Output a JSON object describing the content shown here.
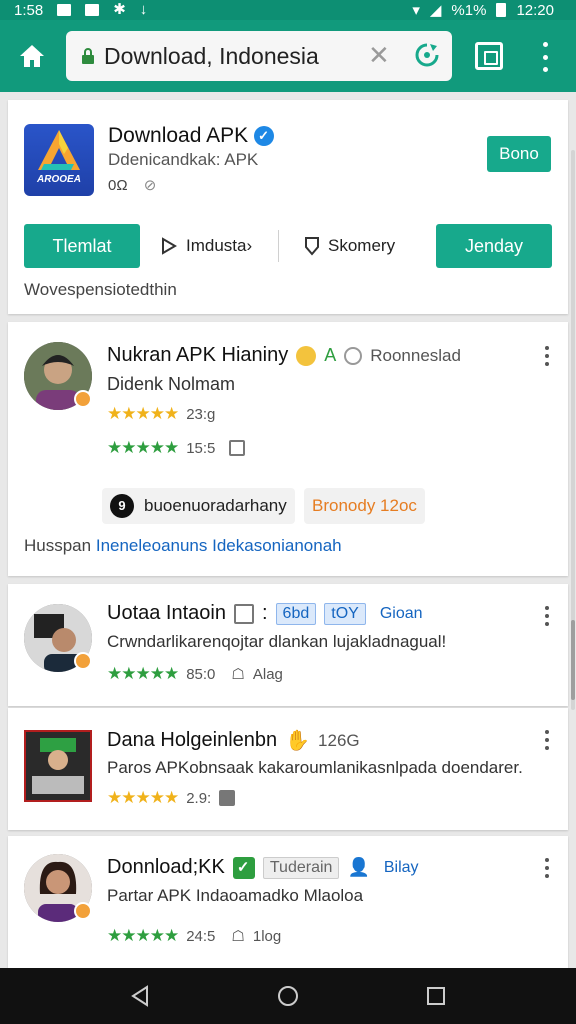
{
  "status_bar": {
    "time_left": "1:58",
    "battery_text": "%1%",
    "time_right": "12:20"
  },
  "browser": {
    "url": "Download, Indonesia"
  },
  "header_card": {
    "title": "Download APK",
    "subtitle": "Ddenicandkak: APK",
    "meta": "0Ω",
    "logo_text": "AROOEA",
    "top_button": "Bono",
    "primary_button": "Tlemlat",
    "link1": "Imdusta›",
    "link2": "Skomery",
    "secondary_button": "Jenday",
    "note": "Wovespensiotedthin"
  },
  "posts": [
    {
      "title": "Nukran APK Hianiny",
      "tag": "Roonneslad",
      "text": "Didenk Nolmam",
      "rating1": "23:g",
      "rating2": "15:5",
      "chip1": "buoenuoradarhany",
      "chip2": "Bronody 12oc",
      "chip_icon_letter": "9",
      "link_prefix": "Husspan",
      "link_text": "Ineneleoanuns Idekasonianonah"
    },
    {
      "title": "Uotaa Intaoin",
      "tag1": "6bd",
      "tag2": "tOY",
      "tag3": "Gioan",
      "text": "Crwndarlikarenqojtar dlankan lujakladnagual!",
      "rating": "85:0",
      "extra": "Alag"
    },
    {
      "title": "Dana Holgeinlenbn",
      "tag": "126G",
      "text": "Paros APKobnsaak kakaroumlanikasnlpada doendarer.",
      "rating": "2.9:"
    },
    {
      "title": "Donnload;KK",
      "tag1": "Tuderain",
      "tag2": "Bilay",
      "text": "Partar APK Indaoamadko Mlaoloa",
      "rating": "24:5",
      "extra": "1log"
    }
  ],
  "colors": {
    "brand": "#119a7c",
    "button": "#17a98c",
    "star_gold": "#f0b21b",
    "star_green": "#2e9e3f",
    "link_blue": "#1565c0"
  }
}
